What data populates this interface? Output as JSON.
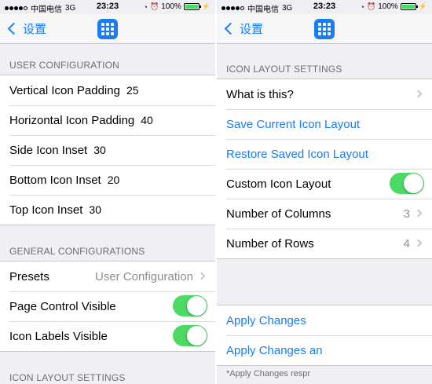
{
  "status_bar": {
    "carrier": "中国电信",
    "network": "3G",
    "time": "23:23",
    "battery_percent": "100%",
    "battery_level": 1.0
  },
  "nav": {
    "back_label": "设置",
    "app_icon": "grid-app-icon"
  },
  "left": {
    "user_config": {
      "header": "USER CONFIGURATION",
      "rows": [
        {
          "label": "Vertical Icon Padding",
          "value": "25"
        },
        {
          "label": "Horizontal Icon Padding",
          "value": "40"
        },
        {
          "label": "Side Icon Inset",
          "value": "30"
        },
        {
          "label": "Bottom Icon Inset",
          "value": "20"
        },
        {
          "label": "Top Icon Inset",
          "value": "30"
        }
      ]
    },
    "general": {
      "header": "GENERAL CONFIGURATIONS",
      "presets_label": "Presets",
      "presets_value": "User Configuration",
      "page_control_label": "Page Control Visible",
      "page_control_on": true,
      "icon_labels_label": "Icon Labels Visible",
      "icon_labels_on": true
    },
    "icon_layout_header": "ICON LAYOUT SETTINGS"
  },
  "right": {
    "icon_layout": {
      "header": "ICON LAYOUT SETTINGS",
      "what_is_this": "What is this?",
      "save_layout": "Save Current Icon Layout",
      "restore_layout": "Restore Saved Icon Layout",
      "custom_layout_label": "Custom Icon Layout",
      "custom_layout_on": true,
      "columns_label": "Number of Columns",
      "columns_value": "3",
      "rows_label": "Number of Rows",
      "rows_value": "4"
    },
    "apply": {
      "apply_changes": "Apply Changes",
      "apply_changes_and": "Apply Changes an",
      "footnote": "*Apply Changes respr"
    }
  },
  "colors": {
    "accent": "#1a7cf5",
    "switch_on": "#4cd964",
    "background": "#efeff4",
    "separator": "#c8c7cc"
  }
}
